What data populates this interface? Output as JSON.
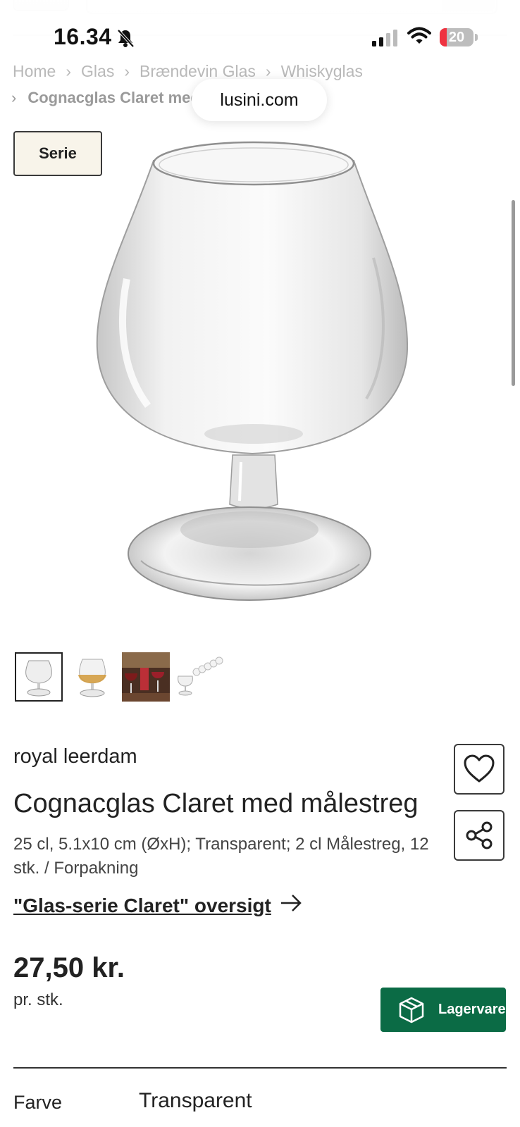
{
  "status_bar": {
    "time": "16.34",
    "battery": "20",
    "silent_icon": "bell-slash-icon",
    "signal_icon": "cellular-signal-icon",
    "wifi_icon": "wifi-icon"
  },
  "breadcrumb": {
    "items": [
      "Home",
      "Glas",
      "Brændevin Glas",
      "Whiskyglas"
    ],
    "current": "Cognacglas Claret med"
  },
  "url_bar": {
    "domain": "lusini.com"
  },
  "badge": {
    "label": "Serie"
  },
  "gallery": {
    "selected_index": 0,
    "thumbnails": [
      "glass-empty",
      "glass-with-cognac",
      "drinks-scene",
      "glass-set"
    ]
  },
  "product": {
    "brand": "royal leerdam",
    "title": "Cognacglas Claret med målestreg",
    "description": "25 cl, 5.1x10 cm (ØxH); Transparent; 2 cl Målestreg, 12 stk. / Forpakning",
    "series_link": "\"Glas-serie Claret\" oversigt ",
    "price": "27,50 kr.",
    "price_unit": "pr. stk.",
    "stock_label": "Lagervare"
  },
  "attributes": [
    {
      "label": "Farve",
      "value": "Transparent"
    }
  ],
  "colors": {
    "accent_green": "#0b6b45",
    "badge_bg": "#f8f4ea",
    "battery_red": "#ef3340"
  }
}
